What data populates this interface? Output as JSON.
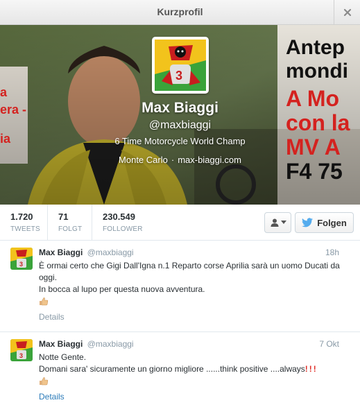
{
  "window": {
    "title": "Kurzprofil"
  },
  "header": {
    "banner_text": [
      "Antep",
      "mondi",
      "A Mo",
      "con la",
      "MV A",
      "F4 75"
    ],
    "left_text": [
      "a",
      "era -",
      "ia"
    ]
  },
  "profile": {
    "name": "Max Biaggi",
    "handle": "@maxbiaggi",
    "bio": "6 Time Motorcycle World Champ",
    "location": "Monte Carlo",
    "separator": "·",
    "url": "max-biaggi.com"
  },
  "stats": {
    "tweets": {
      "value": "1.720",
      "label": "TWEETS"
    },
    "following": {
      "value": "71",
      "label": "FOLGT"
    },
    "followers": {
      "value": "230.549",
      "label": "FOLLOWER"
    }
  },
  "actions": {
    "follow_label": "Folgen"
  },
  "tweets": [
    {
      "name": "Max Biaggi",
      "handle": "@maxbiaggi",
      "time": "18h",
      "lines": [
        "È ormai certo che Gigi Dall'Igna n.1 Reparto corse Aprilia sarà un uomo Ducati da oggi.",
        "In bocca al lupo per questa nuova avventura."
      ],
      "details": "Details"
    },
    {
      "name": "Max Biaggi",
      "handle": "@maxbiaggi",
      "time": "7 Okt",
      "lines": [
        "Notte Gente.",
        "Domani sara' sicuramente un giorno migliore ......think positive ....always"
      ],
      "exclamations": "!!!",
      "details": "Details"
    }
  ],
  "colors": {
    "accent": "#2b7bb9",
    "muted": "#8899a6",
    "twitter_blue": "#55acee"
  },
  "icons": [
    "close-icon",
    "user-icon",
    "caret-down-icon",
    "twitter-bird-icon",
    "thumbs-up-icon"
  ]
}
